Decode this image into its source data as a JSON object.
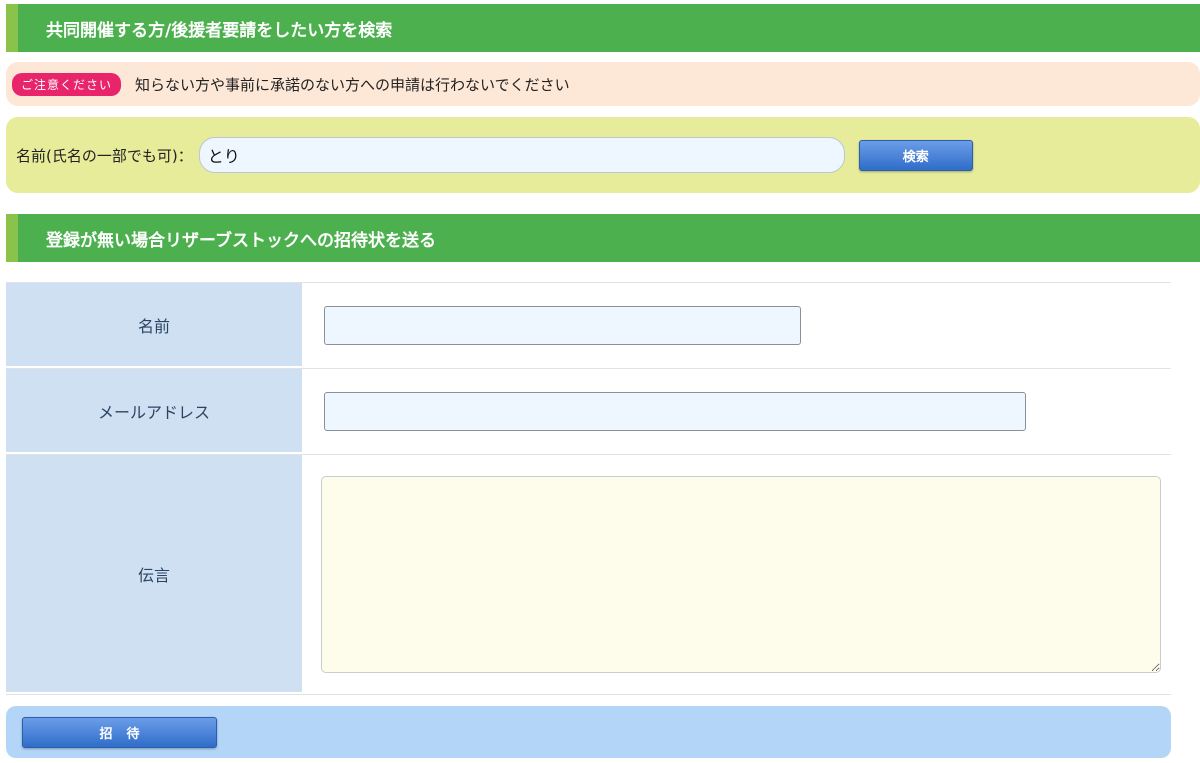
{
  "search_section": {
    "header": "共同開催する方/後援者要請をしたい方を検索",
    "notice_badge": "ご注意ください",
    "notice_text": "知らない方や事前に承諾のない方への申請は行わないでください",
    "label": "名前(氏名の一部でも可)：",
    "input_value": "とり",
    "button_label": "検索"
  },
  "invite_section": {
    "header": "登録が無い場合リザーブストックへの招待状を送る",
    "name_label": "名前",
    "name_value": "",
    "email_label": "メールアドレス",
    "email_value": "",
    "message_label": "伝言",
    "message_value": "",
    "button_label": "招待"
  },
  "colors": {
    "header_green": "#4cb04e",
    "notice_bg": "#fde7d6",
    "badge_pink": "#e8246a",
    "search_bg": "#e6ec99",
    "label_blue": "#cfe0f3",
    "button_blue": "#2f6dc9",
    "footer_blue": "#b3d5f8"
  }
}
